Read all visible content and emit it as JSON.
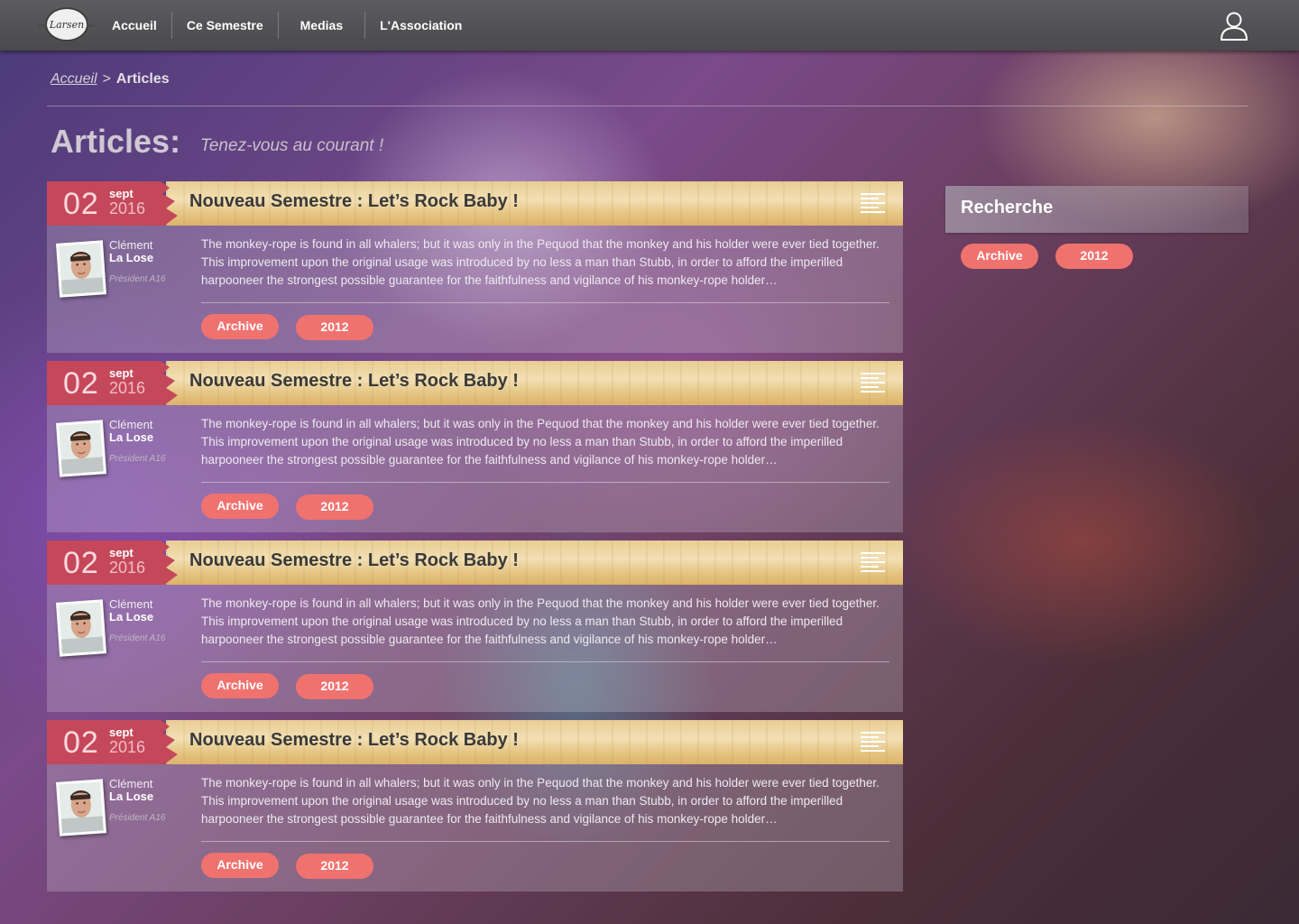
{
  "nav": {
    "logo_text": "Larsen",
    "items": [
      {
        "label": "Accueil"
      },
      {
        "label": "Ce Semestre"
      },
      {
        "label": "Medias"
      },
      {
        "label": "L'Association"
      }
    ]
  },
  "breadcrumb": {
    "home": "Accueil",
    "separator": ">",
    "current": "Articles"
  },
  "page": {
    "title": "Articles:",
    "subtitle": "Tenez-vous au courant !"
  },
  "articles": [
    {
      "day": "02",
      "month": "sept",
      "year": "2016",
      "title": "Nouveau Semestre : Let’s Rock Baby !",
      "author_first": "Clément",
      "author_last": "La Lose",
      "author_role": "Président A16",
      "excerpt": "The monkey-rope is found in all whalers; but it was only in the Pequod that the monkey and his holder were ever tied together. This improvement upon the original usage was introduced by no less a man than Stubb, in order to afford the imperilled harpooneer the strongest possible guarantee for the faithfulness and vigilance of his monkey-rope holder…",
      "tags": [
        "Archive",
        "2012"
      ]
    },
    {
      "day": "02",
      "month": "sept",
      "year": "2016",
      "title": "Nouveau Semestre : Let’s Rock Baby !",
      "author_first": "Clément",
      "author_last": "La Lose",
      "author_role": "Président A16",
      "excerpt": "The monkey-rope is found in all whalers; but it was only in the Pequod that the monkey and his holder were ever tied together. This improvement upon the original usage was introduced by no less a man than Stubb, in order to afford the imperilled harpooneer the strongest possible guarantee for the faithfulness and vigilance of his monkey-rope holder…",
      "tags": [
        "Archive",
        "2012"
      ]
    },
    {
      "day": "02",
      "month": "sept",
      "year": "2016",
      "title": "Nouveau Semestre : Let’s Rock Baby !",
      "author_first": "Clément",
      "author_last": "La Lose",
      "author_role": "Président A16",
      "excerpt": "The monkey-rope is found in all whalers; but it was only in the Pequod that the monkey and his holder were ever tied together. This improvement upon the original usage was introduced by no less a man than Stubb, in order to afford the imperilled harpooneer the strongest possible guarantee for the faithfulness and vigilance of his monkey-rope holder…",
      "tags": [
        "Archive",
        "2012"
      ]
    },
    {
      "day": "02",
      "month": "sept",
      "year": "2016",
      "title": "Nouveau Semestre : Let’s Rock Baby !",
      "author_first": "Clément",
      "author_last": "La Lose",
      "author_role": "Président A16",
      "excerpt": "The monkey-rope is found in all whalers; but it was only in the Pequod that the monkey and his holder were ever tied together. This improvement upon the original usage was introduced by no less a man than Stubb, in order to afford the imperilled harpooneer the strongest possible guarantee for the faithfulness and vigilance of his monkey-rope holder…",
      "tags": [
        "Archive",
        "2012"
      ]
    }
  ],
  "sidebar": {
    "title": "Recherche",
    "tags": [
      "Archive",
      "2012"
    ]
  },
  "colors": {
    "tag": "#f0726f",
    "date_flag": "#c4485a",
    "topbar": "#505053"
  }
}
